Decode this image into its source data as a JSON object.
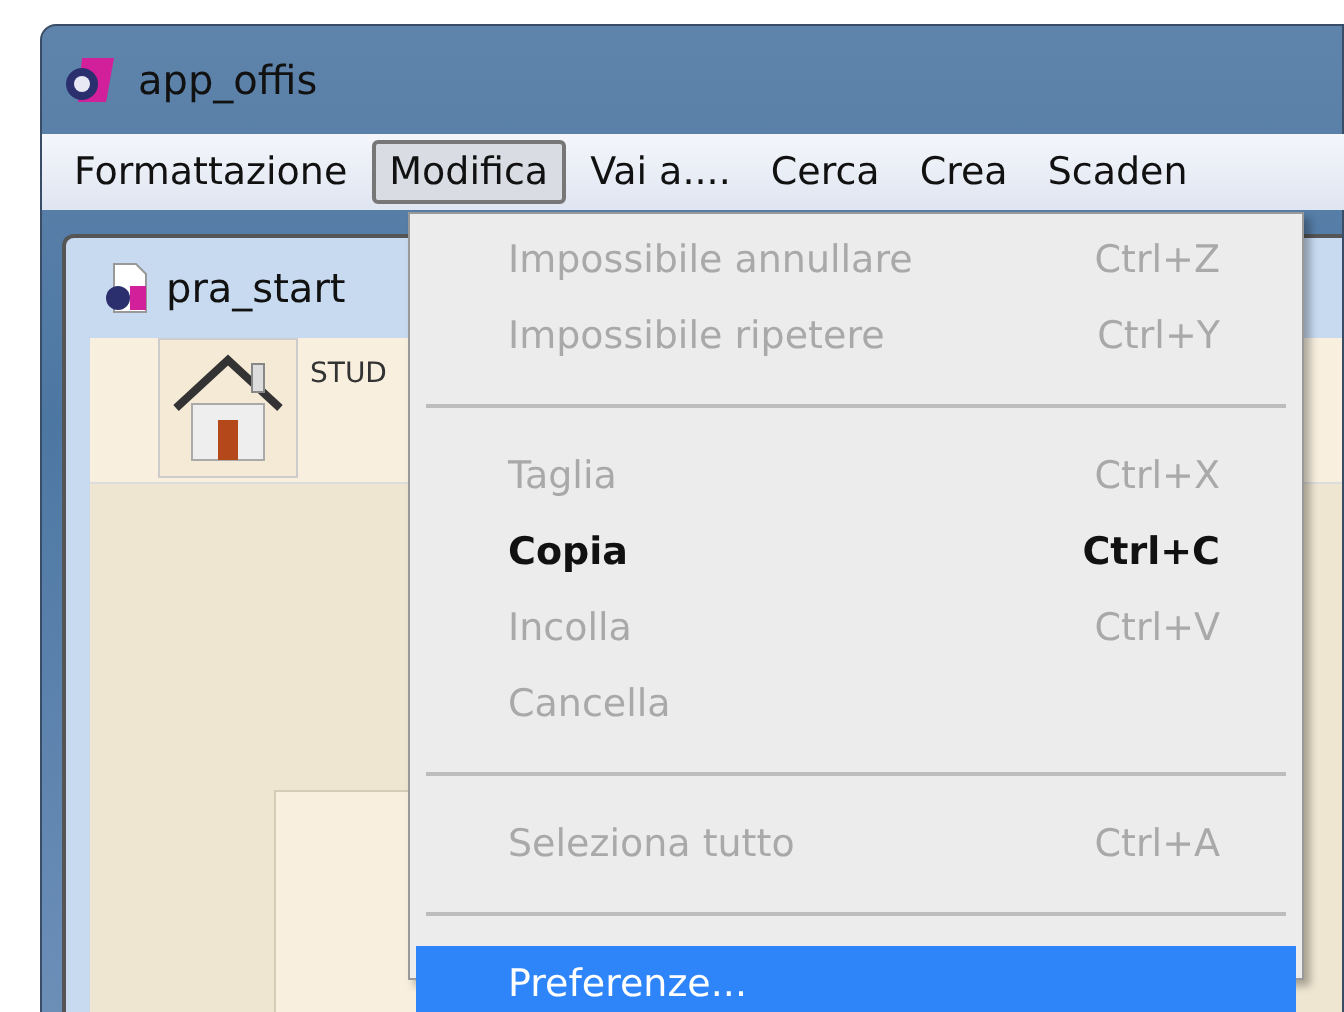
{
  "window": {
    "title": "app_offis"
  },
  "menu_bar": [
    {
      "label": "Formattazione",
      "selected": false
    },
    {
      "label": "Modifica",
      "selected": true
    },
    {
      "label": "Vai a....",
      "selected": false
    },
    {
      "label": "Cerca",
      "selected": false
    },
    {
      "label": "Crea",
      "selected": false
    },
    {
      "label": "Scaden",
      "selected": false
    }
  ],
  "child_window": {
    "title": "pra_start",
    "toolbar_label": "STUD"
  },
  "dropdown": [
    {
      "kind": "item",
      "label": "Impossibile annullare",
      "shortcut": "Ctrl+Z",
      "disabled": true,
      "default": false,
      "selected": false
    },
    {
      "kind": "item",
      "label": "Impossibile ripetere",
      "shortcut": "Ctrl+Y",
      "disabled": true,
      "default": false,
      "selected": false
    },
    {
      "kind": "separator"
    },
    {
      "kind": "item",
      "label": "Taglia",
      "shortcut": "Ctrl+X",
      "disabled": true,
      "default": false,
      "selected": false
    },
    {
      "kind": "item",
      "label": "Copia",
      "shortcut": "Ctrl+C",
      "disabled": false,
      "default": true,
      "selected": false
    },
    {
      "kind": "item",
      "label": "Incolla",
      "shortcut": "Ctrl+V",
      "disabled": true,
      "default": false,
      "selected": false
    },
    {
      "kind": "item",
      "label": "Cancella",
      "disabled": true,
      "default": false,
      "selected": false
    },
    {
      "kind": "separator"
    },
    {
      "kind": "item",
      "label": "Seleziona tutto",
      "shortcut": "Ctrl+A",
      "disabled": true,
      "default": false,
      "selected": false
    },
    {
      "kind": "separator"
    },
    {
      "kind": "item",
      "label": "Preferenze...",
      "disabled": false,
      "default": false,
      "selected": true
    }
  ]
}
